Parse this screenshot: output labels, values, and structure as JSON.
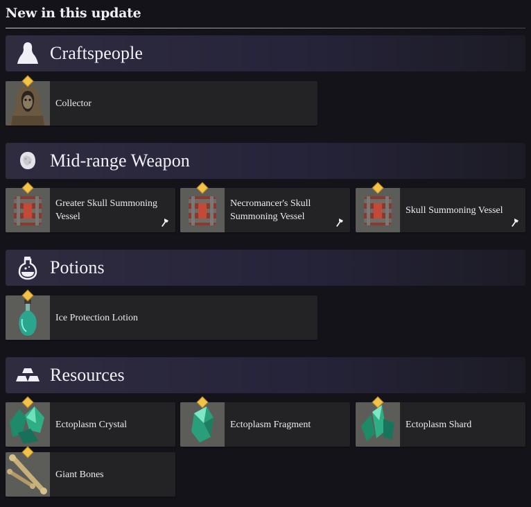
{
  "page": {
    "title": "New in this update"
  },
  "sections": [
    {
      "title": "Craftspeople",
      "icon": "person-silhouette-icon",
      "items": [
        {
          "label": "Collector",
          "thumb": "hooded-figure-portrait",
          "new": true
        }
      ]
    },
    {
      "title": "Mid-range Weapon",
      "icon": "stone-orb-icon",
      "items": [
        {
          "label": "Greater Skull Summoning Vessel",
          "thumb": "vessel-icon",
          "new": true,
          "craftable": true
        },
        {
          "label": "Necromancer's Skull Summoning Vessel",
          "thumb": "vessel-icon",
          "new": true,
          "craftable": true
        },
        {
          "label": "Skull Summoning Vessel",
          "thumb": "vessel-icon",
          "new": true,
          "craftable": true
        }
      ]
    },
    {
      "title": "Potions",
      "icon": "potion-flask-icon",
      "items": [
        {
          "label": "Ice Protection Lotion",
          "thumb": "potion-bottle",
          "new": true
        }
      ]
    },
    {
      "title": "Resources",
      "icon": "ingots-icon",
      "items": [
        {
          "label": "Ectoplasm Crystal",
          "thumb": "green-crystal",
          "new": true
        },
        {
          "label": "Ectoplasm Fragment",
          "thumb": "green-fragment",
          "new": true
        },
        {
          "label": "Ectoplasm Shard",
          "thumb": "green-shard",
          "new": true
        },
        {
          "label": "Giant Bones",
          "thumb": "bones",
          "new": true
        }
      ]
    }
  ],
  "colors": {
    "background": "#14131a",
    "header": "#2f2c40",
    "item": "#232325",
    "badge": "#f2c24a"
  }
}
